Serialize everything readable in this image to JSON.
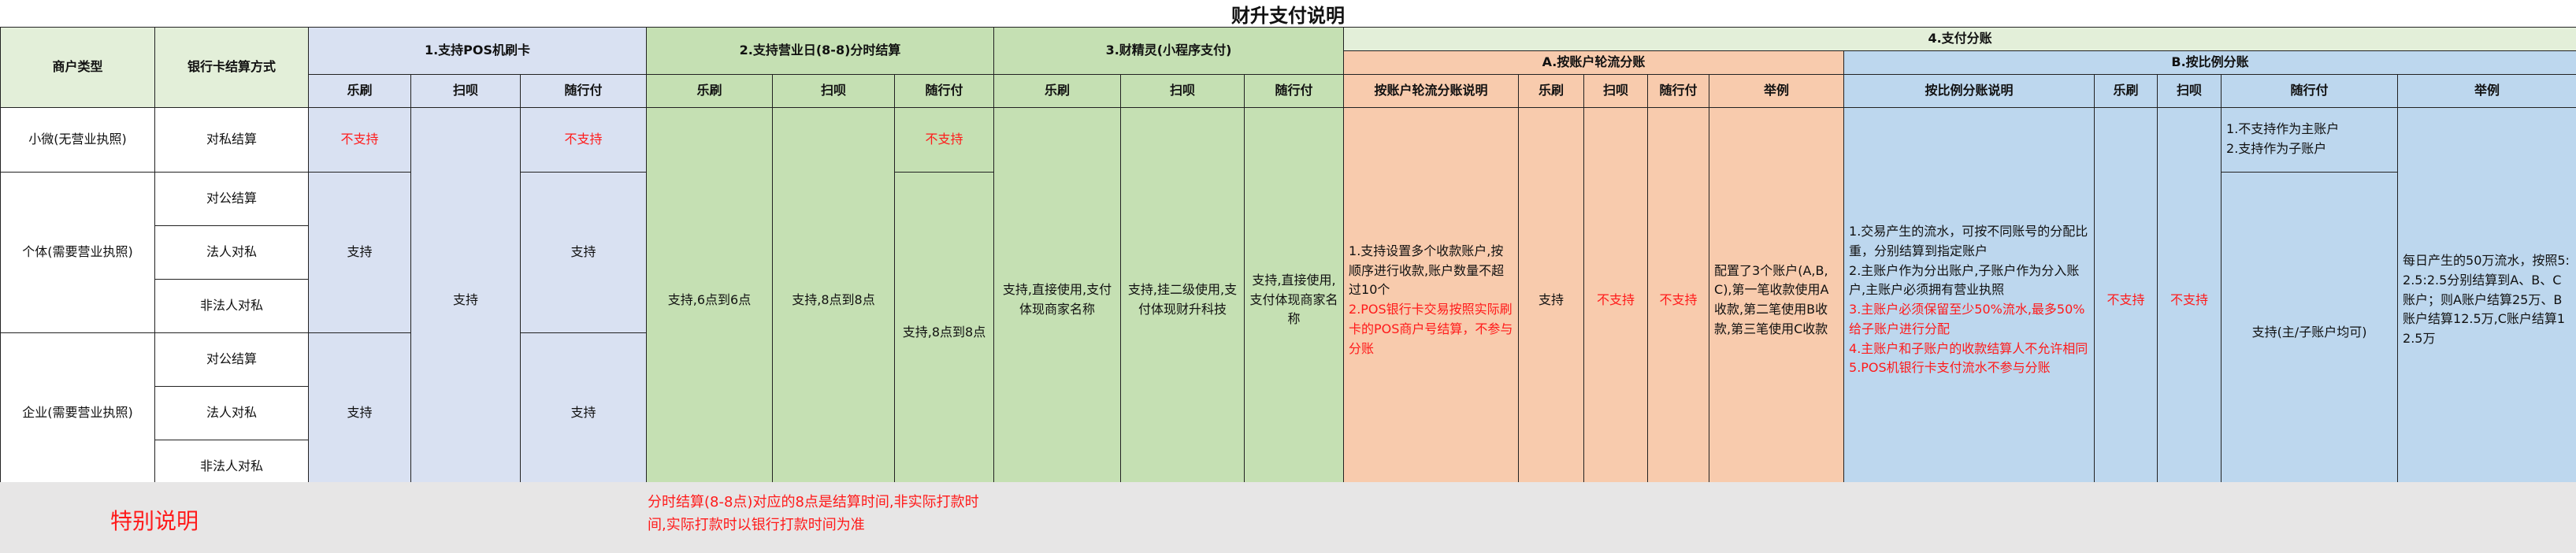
{
  "title": "财升支付说明",
  "headers": {
    "merchant_type": "商户类型",
    "settle_method": "银行卡结算方式",
    "g1": "1.支持POS机刷卡",
    "g2": "2.支持营业日(8-8)分时结算",
    "g3": "3.财精灵(小程序支付)",
    "g4": "4.支付分账",
    "g4a": "A.按账户轮流分账",
    "g4b": "B.按比例分账",
    "lepos": "乐刷",
    "saobei": "扫呗",
    "suixingfu": "随行付",
    "a_desc": "按账户轮流分账说明",
    "example": "举例",
    "b_desc": "按比例分账说明"
  },
  "rows": {
    "m_small": "小微(无营业执照)",
    "m_ind": "个体(需要营业执照)",
    "m_ent": "企业(需要营业执照)",
    "s_private": "对私结算",
    "s_public": "对公结算",
    "s_legal": "法人对私",
    "s_nonlegal": "非法人对私"
  },
  "cells": {
    "not_supported": "不支持",
    "supported": "支持",
    "g2_time": "支持,6点到6点",
    "g2_time8": "支持,8点到8点",
    "g3_lepos": "支持,直接使用,支付体现商家名称",
    "g3_saobei": "支持,挂二级使用,支付体现财升科技",
    "g3_suixingfu": "支持,直接使用,支付体现商家名称",
    "a_desc_lines": [
      "1.支持设置多个收款账户,按顺序进行收款,账户数量不超过10个",
      "2.POS银行卡交易按照实际刷卡的POS商户号结算，不参与分账"
    ],
    "a_example": "配置了3个账户(A,B,C),第一笔收款使用A收款,第二笔使用B收款,第三笔使用C收款",
    "b_desc_lines": [
      "1.交易产生的流水，可按不同账号的分配比重，分别结算到指定账户",
      "2.主账户作为分出账户,子账户作为分入账户,主账户必须拥有营业执照",
      "3.主账户必须保留至少50%流水,最多50%给子账户进行分配",
      "4.主账户和子账户的收款结算人不允许相同",
      "5.POS机银行卡支付流水不参与分账"
    ],
    "b_sxf_top": [
      "1.不支持作为主账户",
      "2.支持作为子账户"
    ],
    "b_sxf_bottom": "支持(主/子账户均可)",
    "b_example": "每日产生的50万流水，按照5:2.5:2.5分别结算到A、B、C账户；则A账户结算25万、B账户结算12.5万,C账户结算12.5万"
  },
  "special": {
    "title": "特别说明",
    "note": "分时结算(8-8点)对应的8点是结算时间,非实际打款时间,实际打款时以银行打款时间为准"
  },
  "colors": {
    "lavender": "#d9e1f2",
    "green": "#c5e0b3",
    "orange": "#f8cbad",
    "sky": "#bdd7ee",
    "red_text": "#ff1a1a",
    "gray_footer": "#e7e6e6"
  }
}
